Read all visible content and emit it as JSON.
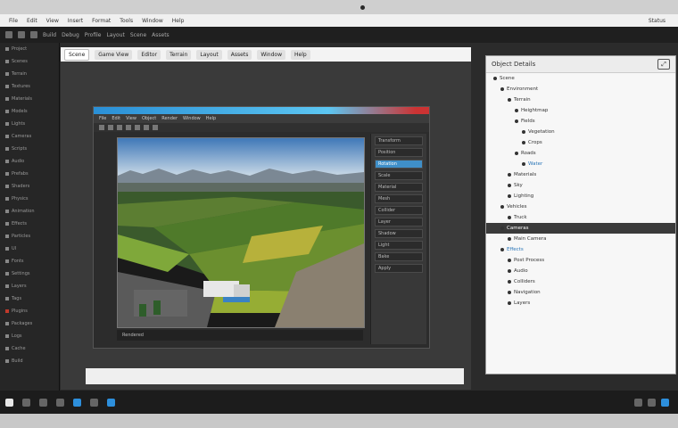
{
  "os_menubar": {
    "items": [
      "File",
      "Edit",
      "View",
      "Insert",
      "Format",
      "Tools",
      "Window",
      "Help"
    ],
    "right": [
      "Status"
    ]
  },
  "app_toolbar": {
    "labels": [
      "Build",
      "Debug",
      "Profile",
      "Layout",
      "Scene",
      "Assets"
    ]
  },
  "left_panel": {
    "items": [
      "Project",
      "Scenes",
      "Terrain",
      "Textures",
      "Materials",
      "Models",
      "Lights",
      "Cameras",
      "Scripts",
      "Audio",
      "Prefabs",
      "Shaders",
      "Physics",
      "Animation",
      "Effects",
      "Particles",
      "UI",
      "Fonts",
      "Settings",
      "Layers",
      "Tags",
      "Plugins",
      "Packages",
      "Logs",
      "Cache",
      "Build"
    ]
  },
  "main_tabs": [
    "Scene",
    "Game View",
    "Editor",
    "Terrain",
    "Layout",
    "Assets",
    "Window",
    "Help"
  ],
  "inner_window": {
    "menu": [
      "File",
      "Edit",
      "View",
      "Object",
      "Render",
      "Window",
      "Help"
    ],
    "status": "Rendered"
  },
  "side_props": [
    "Transform",
    "Position",
    "Rotation",
    "Scale",
    "Material",
    "Mesh",
    "Collider",
    "Layer",
    "Shadow",
    "Light",
    "Bake",
    "Apply"
  ],
  "right_panel": {
    "title": "Object Details",
    "tree": [
      "Scene",
      "Environment",
      "Terrain",
      "Heightmap",
      "Fields",
      "Vegetation",
      "Crops",
      "Roads",
      "Water",
      "Materials",
      "Sky",
      "Lighting",
      "Vehicles",
      "Truck",
      "Cameras",
      "Main Camera",
      "Effects",
      "Post Process",
      "Audio",
      "Colliders",
      "Navigation",
      "Layers"
    ],
    "selected_index": 14,
    "link_indices": [
      8,
      16
    ]
  },
  "colors": {
    "accent_blue": "#2a8fd6",
    "title_red": "#cc3333"
  }
}
